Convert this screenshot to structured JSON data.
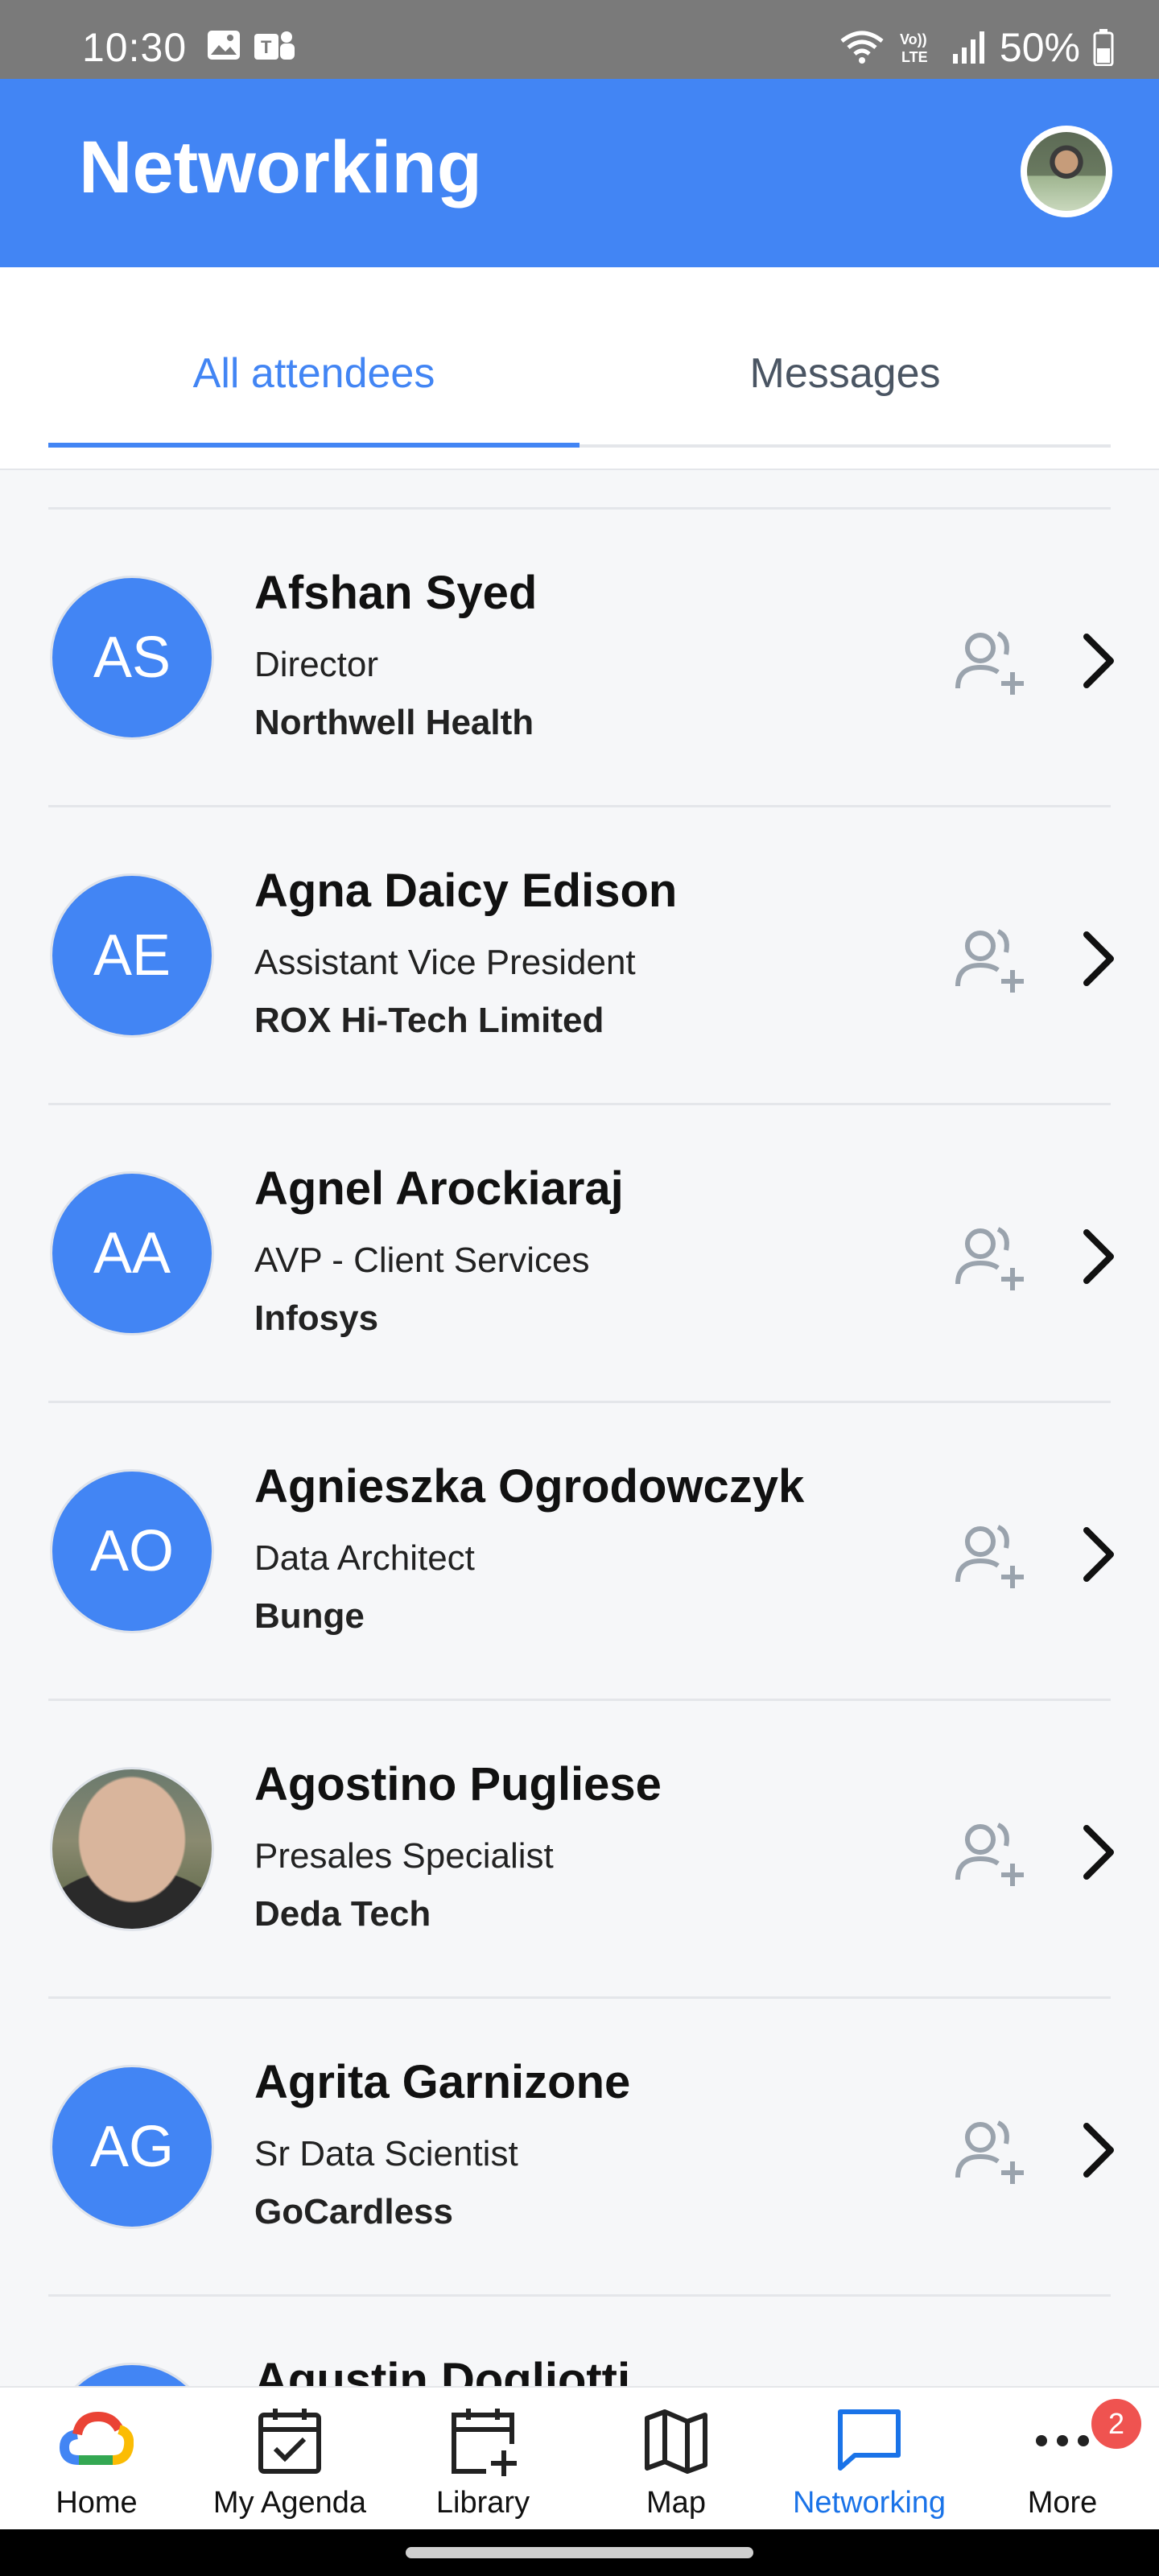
{
  "status_bar": {
    "time": "10:30",
    "battery": "50%",
    "left_icons": [
      "gallery-icon",
      "teams-icon"
    ],
    "right_icons": [
      "wifi-icon",
      "volte-icon",
      "signal-icon",
      "battery-icon"
    ]
  },
  "app_bar": {
    "title": "Networking",
    "background_color": "#4285f4"
  },
  "tabs": [
    {
      "label": "All attendees",
      "active": true
    },
    {
      "label": "Messages",
      "active": false
    }
  ],
  "attendees": [
    {
      "initials": "AS",
      "name": "Afshan Syed",
      "role": "Director",
      "company": "Northwell Health",
      "photo": false
    },
    {
      "initials": "AE",
      "name": "Agna Daicy Edison",
      "role": "Assistant Vice President",
      "company": "ROX Hi-Tech Limited",
      "photo": false
    },
    {
      "initials": "AA",
      "name": "Agnel Arockiaraj",
      "role": "AVP - Client Services",
      "company": "Infosys",
      "photo": false
    },
    {
      "initials": "AO",
      "name": "Agnieszka Ogrodowczyk",
      "role": "Data Architect",
      "company": "Bunge",
      "photo": false
    },
    {
      "initials": "",
      "name": "Agostino Pugliese",
      "role": "Presales Specialist",
      "company": "Deda Tech",
      "photo": true
    },
    {
      "initials": "AG",
      "name": "Agrita Garnizone",
      "role": "Sr Data Scientist",
      "company": "GoCardless",
      "photo": false
    },
    {
      "initials": "",
      "name": "Agustin Dogliotti",
      "role": "",
      "company": "",
      "photo": false
    }
  ],
  "bottom_nav": [
    {
      "label": "Home",
      "icon": "google-cloud-icon"
    },
    {
      "label": "My Agenda",
      "icon": "calendar-check-icon"
    },
    {
      "label": "Library",
      "icon": "calendar-add-icon"
    },
    {
      "label": "Map",
      "icon": "map-icon"
    },
    {
      "label": "Networking",
      "icon": "chat-icon",
      "active": true
    },
    {
      "label": "More",
      "icon": "more-dots-icon",
      "badge": "2"
    }
  ],
  "colors": {
    "accent": "#4285f4",
    "active_nav": "#1a73e8",
    "badge": "#ef5350",
    "icon_gray": "#9aa3ad"
  }
}
